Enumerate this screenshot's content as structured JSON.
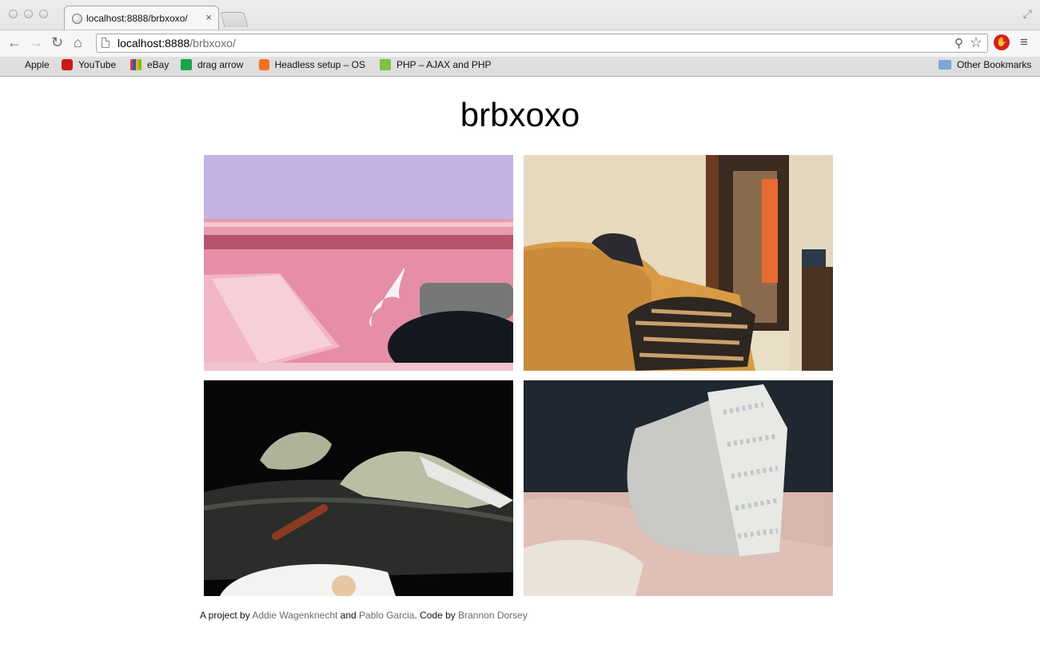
{
  "browser": {
    "tab_title": "localhost:8888/brbxoxo/",
    "tab_close": "×",
    "url_host": "localhost:8888",
    "url_path": "/brbxoxo/",
    "bookmarks": [
      {
        "label": "Apple",
        "icon": "apple-icon"
      },
      {
        "label": "YouTube",
        "icon": "youtube-icon"
      },
      {
        "label": "eBay",
        "icon": "ebay-icon"
      },
      {
        "label": "drag arrow",
        "icon": "play-icon"
      },
      {
        "label": "Headless setup – OS",
        "icon": "blogger-icon"
      },
      {
        "label": "PHP – AJAX and PHP",
        "icon": "php-icon"
      }
    ],
    "other_bookmarks": "Other Bookmarks"
  },
  "page": {
    "title": "brbxoxo",
    "videos": [
      {
        "name": "pink-bedroom-feed"
      },
      {
        "name": "orange-couch-feed"
      },
      {
        "name": "dark-bed-feed"
      },
      {
        "name": "pink-pillow-feed"
      }
    ],
    "footer": {
      "prefix": "A project by ",
      "author1": "Addie Wagenknecht",
      "and": " and ",
      "author2": "Pablo Garcia",
      "code_by": ". Code by ",
      "author3": "Brannon Dorsey"
    }
  }
}
